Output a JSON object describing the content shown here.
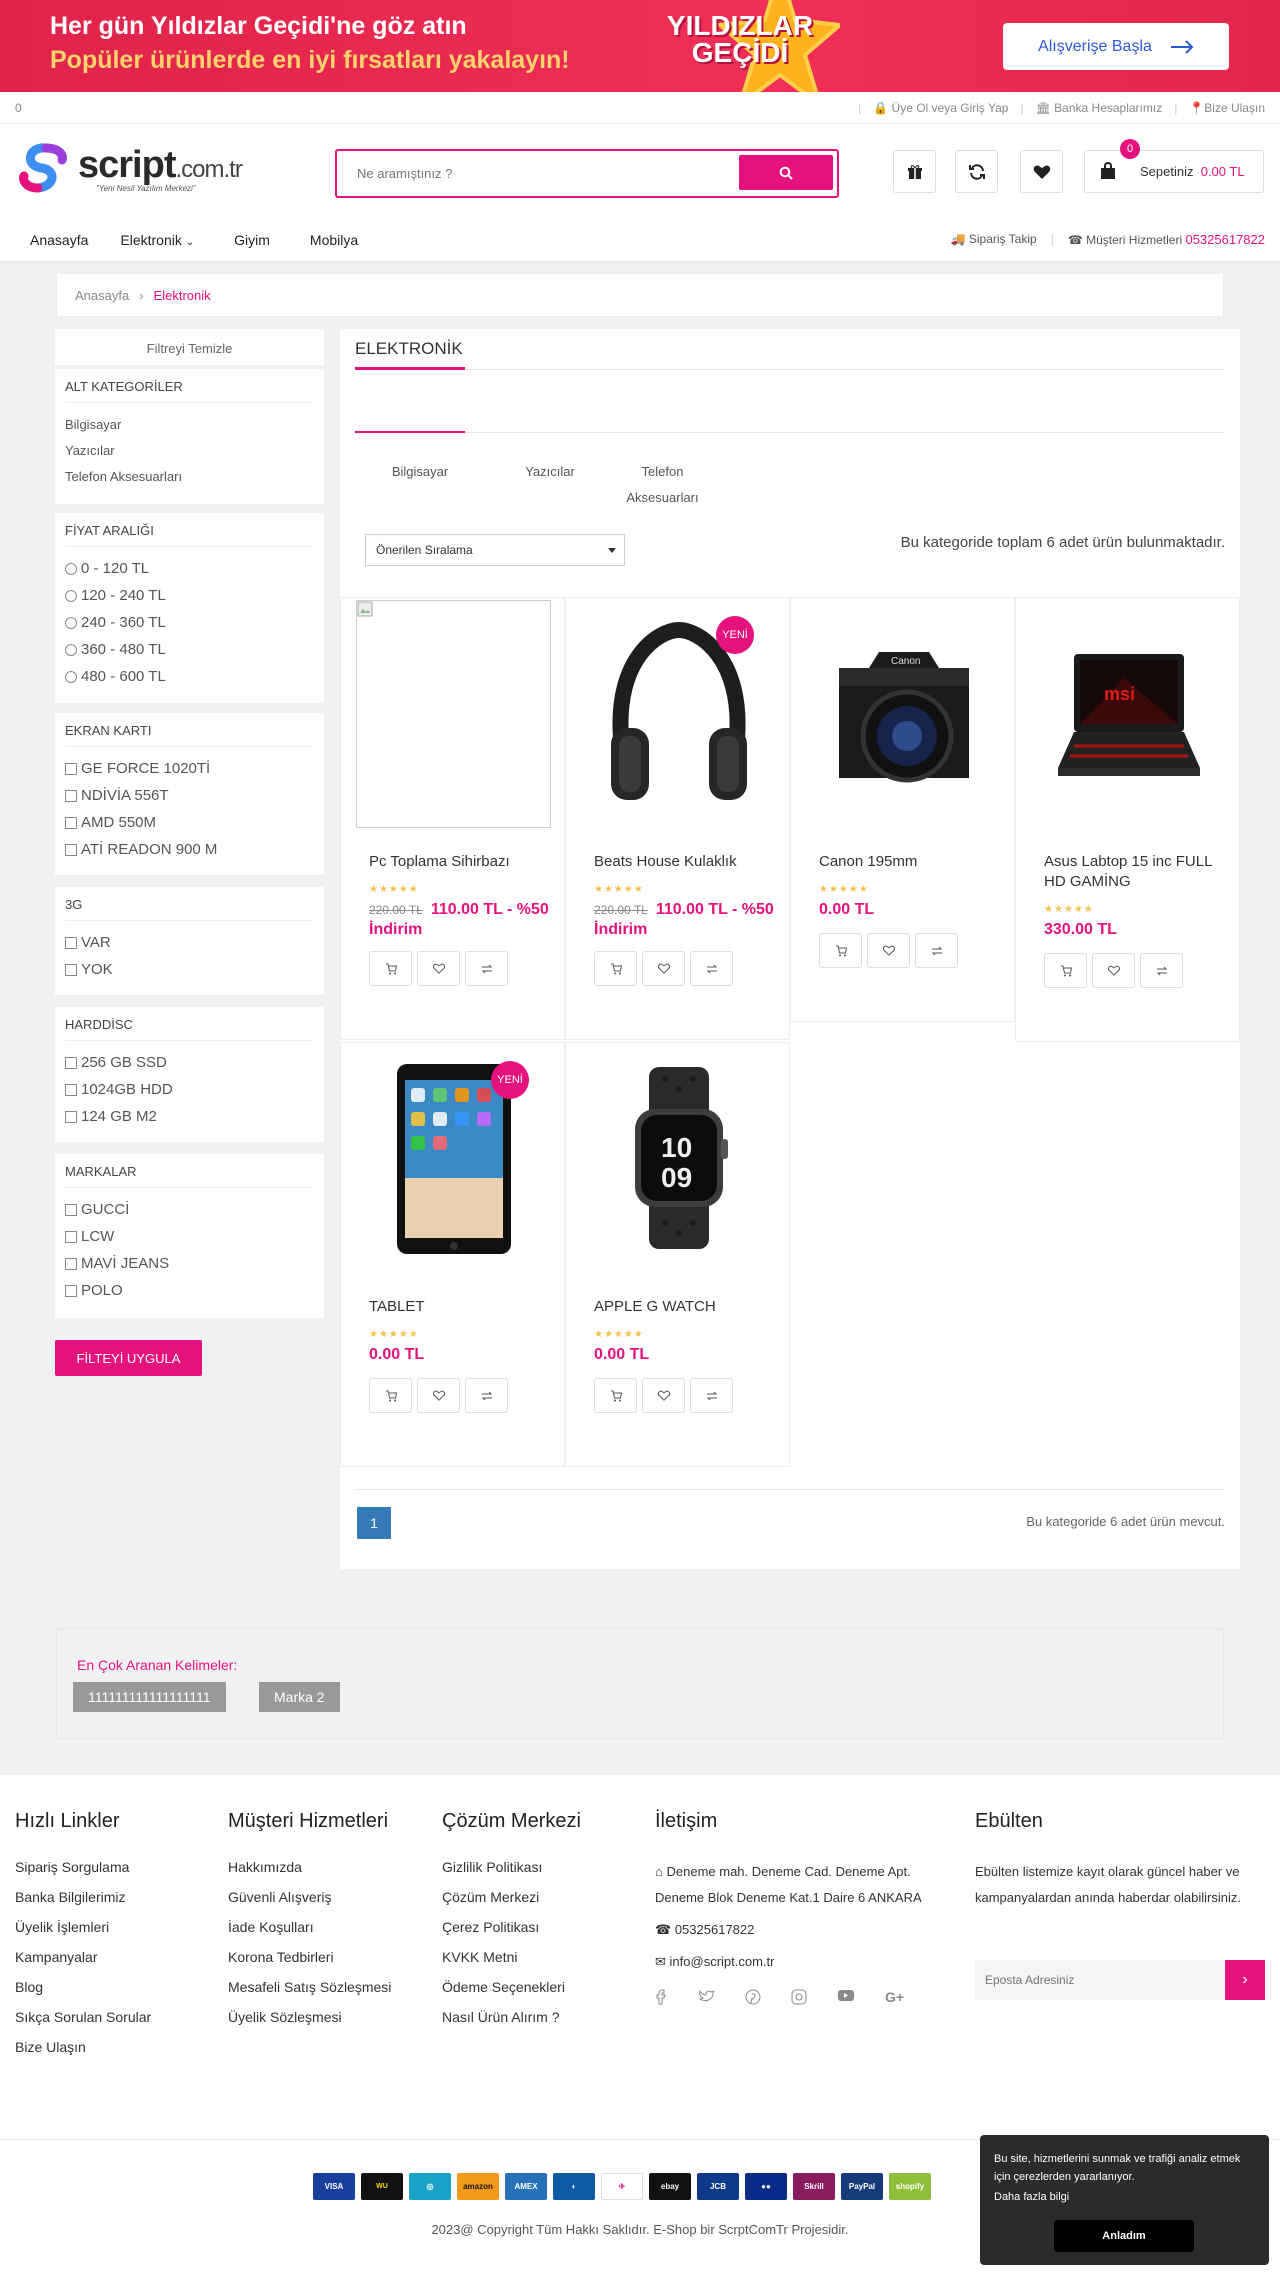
{
  "promo": {
    "line1": "Her gün Yıldızlar Geçidi'ne göz atın",
    "line2": "Popüler ürünlerde en iyi fırsatları yakalayın!",
    "badge_l1": "YILDIZLAR",
    "badge_l2": "GEÇİDİ",
    "cta": "Alışverişe Başla"
  },
  "topbar": {
    "count": "0",
    "links": [
      "Üye Ol veya Giriş Yap",
      "Banka Hesaplarımız",
      "Bize Ulaşın"
    ]
  },
  "logo": {
    "main": "script",
    "tld": ".com.tr",
    "slogan": "\"Yeni Nesil Yazılım Merkezi\""
  },
  "search": {
    "placeholder": "Ne aramıştınız ?"
  },
  "cart": {
    "badge": "0",
    "label": "Sepetiniz",
    "amount": "0.00 TL"
  },
  "nav": {
    "items": [
      "Anasayfa",
      "Elektronik",
      "Giyim",
      "Mobilya"
    ],
    "order_track": "Sipariş Takip",
    "service": "Müşteri Hizmetleri",
    "phone": "05325617822"
  },
  "breadcrumb": {
    "home": "Anasayfa",
    "current": "Elektronik"
  },
  "sidebar": {
    "clear": "Filtreyi Temizle",
    "subcat_title": "ALT KATEGORİLER",
    "subcats": [
      "Bilgisayar",
      "Yazıcılar",
      "Telefon Aksesuarları"
    ],
    "price_title": "FİYAT ARALIĞI",
    "prices": [
      "0 - 120 TL",
      "120 - 240 TL",
      "240 - 360 TL",
      "360 - 480 TL",
      "480 - 600 TL"
    ],
    "gpu_title": "EKRAN KARTI",
    "gpus": [
      "GE FORCE 1020Tİ",
      "NDİVİA 556T",
      "AMD 550M",
      "ATİ READON 900 M"
    ],
    "g3_title": "3G",
    "g3": [
      "VAR",
      "YOK"
    ],
    "hdd_title": "HARDDİSC",
    "hdd": [
      "256 GB SSD",
      "1024GB HDD",
      "124 GB M2"
    ],
    "brand_title": "MARKALAR",
    "brands": [
      "GUCCİ",
      "LCW",
      "MAVİ JEANS",
      "POLO"
    ],
    "apply": "FİLTEYİ UYGULA"
  },
  "main": {
    "title": "ELEKTRONİK",
    "subcats": [
      "Bilgisayar",
      "Yazıcılar",
      "Telefon Aksesuarları"
    ],
    "sort": "Önerilen Sıralama",
    "total": "Bu kategoride toplam 6 adet ürün bulunmaktadır.",
    "new_label": "YENİ",
    "stars": "★★★★★",
    "page": "1",
    "page_text": "Bu kategoride 6 adet ürün mevcut."
  },
  "products": [
    {
      "name": "Pc Toplama Sihirbazı",
      "old": "220.00 TL",
      "price": "110.00 TL - %50 İndirim"
    },
    {
      "name": "Beats House Kulaklık",
      "old": "220.00 TL",
      "price": "110.00 TL - %50 İndirim"
    },
    {
      "name": "Canon 195mm",
      "price": "0.00 TL"
    },
    {
      "name": "Asus Labtop 15 inc FULL HD GAMİNG",
      "price": "330.00 TL"
    },
    {
      "name": "TABLET",
      "price": "0.00 TL"
    },
    {
      "name": "APPLE G WATCH",
      "price": "0.00 TL"
    }
  ],
  "keywords": {
    "title": "En Çok Aranan Kelimeler:",
    "tags": [
      "111111111111111111",
      "Marka 2"
    ]
  },
  "footer": {
    "col1_title": "Hızlı Linkler",
    "col1": [
      "Sipariş Sorgulama",
      "Banka Bilgilerimiz",
      "Üyelik İşlemleri",
      "Kampanyalar",
      "Blog",
      "Sıkça Sorulan Sorular",
      "Bize Ulaşın"
    ],
    "col2_title": "Müşteri Hizmetleri",
    "col2": [
      "Hakkımızda",
      "Güvenli Alışveriş",
      "İade Koşulları",
      "Korona Tedbirleri",
      "Mesafeli Satış Sözleşmesi",
      "Üyelik Sözleşmesi"
    ],
    "col3_title": "Çözüm Merkezi",
    "col3": [
      "Gizlilik Politikası",
      "Çözüm Merkezi",
      "Çerez Politikası",
      "KVKK Metni",
      "Ödeme Seçenekleri",
      "Nasıl Ürün Alırım ?"
    ],
    "contact_title": "İletişim",
    "address": "Deneme mah. Deneme Cad. Deneme Apt. Deneme Blok Deneme Kat.1 Daire 6 ANKARA",
    "phone": "05325617822",
    "email": "info@script.com.tr",
    "newsletter_title": "Ebülten",
    "newsletter_text": "Ebülten listemize kayıt olarak güncel haber ve kampanyalardan anında haberdar olabilirsiniz.",
    "email_placeholder": "Eposta Adresiniz",
    "payments": [
      "VISA",
      "",
      "",
      "amazon",
      "",
      "",
      "",
      "ebay",
      "JCB",
      "",
      "Skrill",
      "PayPal",
      "shopify"
    ],
    "copyright": "2023@ Copyright Tüm Hakkı Saklıdır. E-Shop bir ScrptComTr Projesidir."
  },
  "cookie": {
    "text": "Bu site, hizmetlerini sunmak ve trafiği analiz etmek için çerezlerden yararlanıyor.",
    "more": "Daha fazla bilgi",
    "ok": "Anladım"
  },
  "colors": {
    "accent": "#e5127d",
    "promo": "#e8294f",
    "page_blue": "#337ab7"
  }
}
